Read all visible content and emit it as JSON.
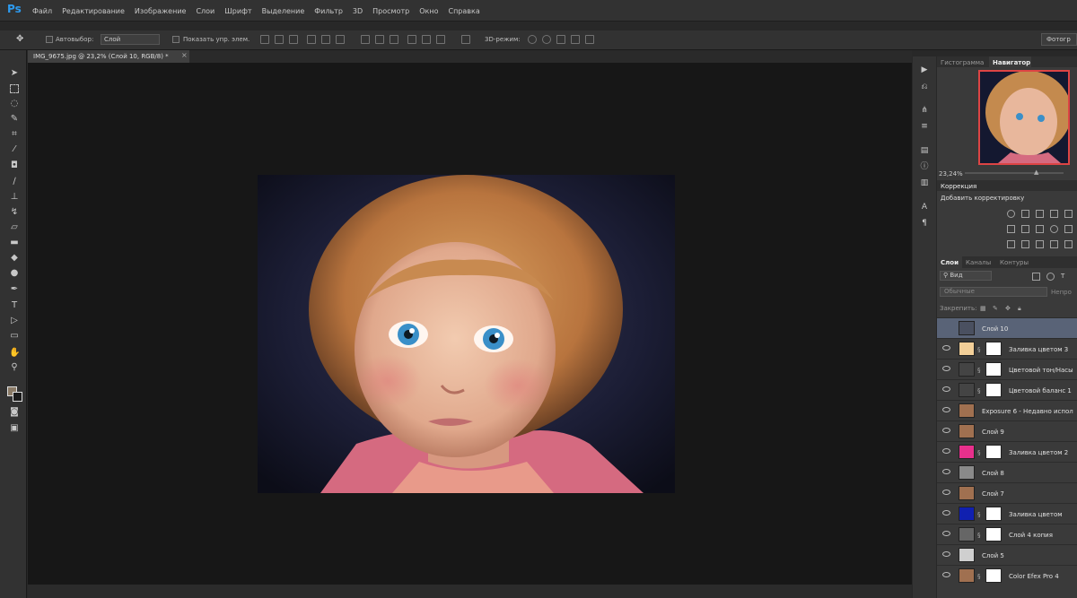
{
  "app": {
    "logo": "Ps"
  },
  "menu": [
    "Файл",
    "Редактирование",
    "Изображение",
    "Слои",
    "Шрифт",
    "Выделение",
    "Фильтр",
    "3D",
    "Просмотр",
    "Окно",
    "Справка"
  ],
  "options": {
    "autoselect_label": "Автовыбор:",
    "autoselect_value": "Слой",
    "show_controls_label": "Показать упр. элем.",
    "mode_3d_label": "3D-режим:",
    "workspace_label": "Фотогр"
  },
  "document": {
    "tab_title": "IMG_9675.jpg @ 23,2% (Слой 10, RGB/8) *"
  },
  "panels": {
    "top_tabs": [
      "Гистограмма",
      "Навигатор"
    ],
    "zoom": "23,24%",
    "corrections_tab": "Коррекция",
    "corrections_title": "Добавить корректировку",
    "layers_tabs": [
      "Слои",
      "Каналы",
      "Контуры"
    ],
    "search_label": "Вид",
    "blend_mode": "Обычные",
    "opacity_label": "Непро",
    "lock_label": "Закрепить:"
  },
  "layers": [
    {
      "name": "Слой 10",
      "selected": true,
      "thumb": "#4a5060",
      "mask": false
    },
    {
      "name": "Заливка цветом 3",
      "selected": false,
      "thumb": "#f2cf98",
      "mask": true
    },
    {
      "name": "Цветовой тон/Насы",
      "selected": false,
      "thumb": "#444",
      "mask": true
    },
    {
      "name": "Цветовой баланс 1",
      "selected": false,
      "thumb": "#444",
      "mask": true
    },
    {
      "name": "Exposure 6 - Недавно испол",
      "selected": false,
      "thumb": "#a07050",
      "mask": false
    },
    {
      "name": "Слой 9",
      "selected": false,
      "thumb": "#a07050",
      "mask": false
    },
    {
      "name": "Заливка цветом 2",
      "selected": false,
      "thumb": "#e8308c",
      "mask": true
    },
    {
      "name": "Слой 8",
      "selected": false,
      "thumb": "#8a8a8a",
      "mask": false
    },
    {
      "name": "Слой 7",
      "selected": false,
      "thumb": "#a07050",
      "mask": false
    },
    {
      "name": "Заливка цветом",
      "selected": false,
      "thumb": "#1020b0",
      "mask": true
    },
    {
      "name": "Слой 4 копия",
      "selected": false,
      "thumb": "#666",
      "mask": true
    },
    {
      "name": "Слой 5",
      "selected": false,
      "thumb": "#cfcfcf",
      "mask": false
    },
    {
      "name": "Color Efex Pro 4",
      "selected": false,
      "thumb": "#a07050",
      "mask": true
    }
  ],
  "colors": {
    "accent": "#2d9bf0",
    "selected_layer": "#596377",
    "fg": "#8a7a66",
    "bg": "#1b1b1b"
  }
}
